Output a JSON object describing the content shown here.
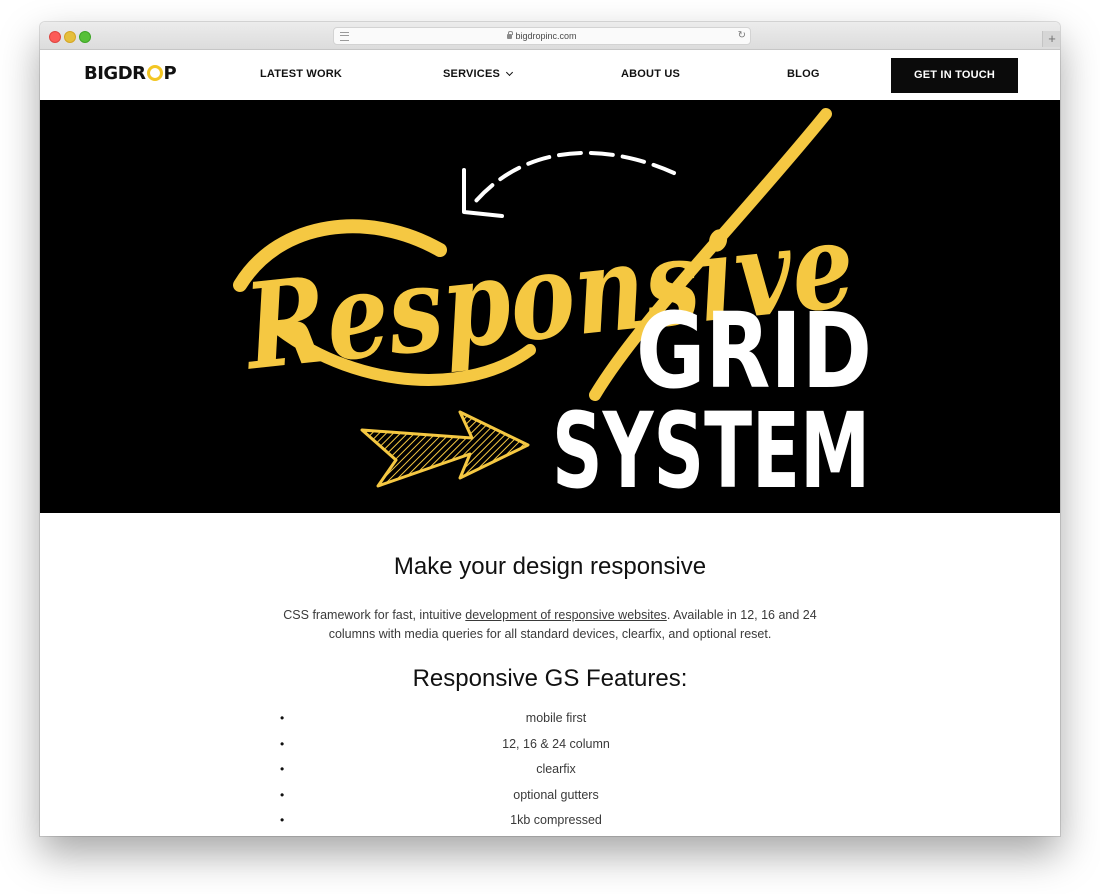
{
  "browser": {
    "url": "bigdropinc.com"
  },
  "nav": {
    "logo": {
      "before": "BIGDR",
      "after": "P"
    },
    "items": [
      {
        "label": "LATEST WORK"
      },
      {
        "label": "SERVICES"
      },
      {
        "label": "ABOUT US"
      },
      {
        "label": "BLOG"
      }
    ],
    "cta": "GET IN TOUCH"
  },
  "hero": {
    "script_word": "Responsive",
    "block_line1": "GRID",
    "block_line2": "SYSTEM",
    "colors": {
      "background": "#000000",
      "accent": "#f5c842",
      "text": "#ffffff"
    }
  },
  "content": {
    "heading": "Make your design responsive",
    "intro_before": "CSS framework for fast, intuitive ",
    "intro_link": "development of responsive websites",
    "intro_after": ". Available in 12, 16 and 24 columns with media queries for all standard devices, clearfix, and optional reset.",
    "features_heading": "Responsive GS Features:",
    "features": [
      "mobile first",
      "12, 16 & 24 column",
      "clearfix",
      "optional gutters",
      "1kb compressed"
    ]
  }
}
